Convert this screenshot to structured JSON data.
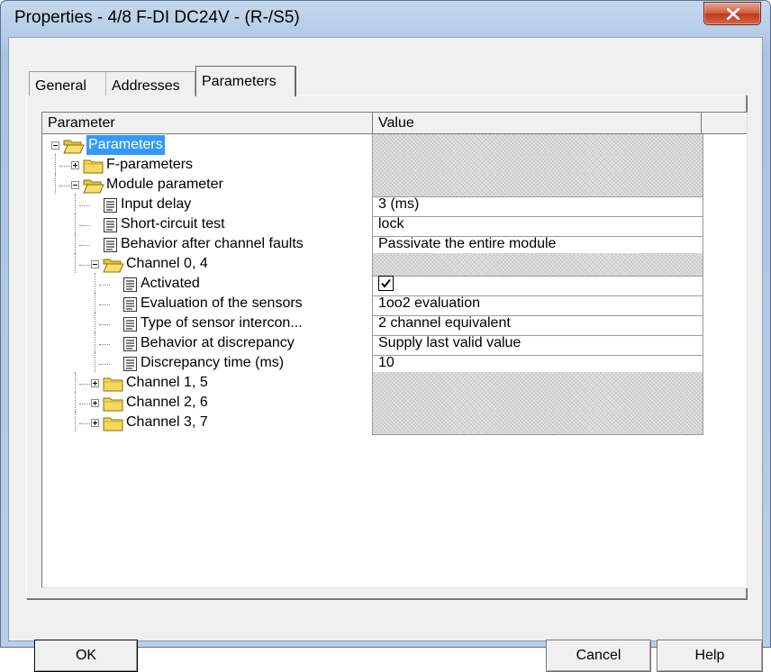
{
  "window": {
    "title": "Properties - 4/8 F-DI DC24V - (R-/S5)"
  },
  "tabs": [
    {
      "label": "General"
    },
    {
      "label": "Addresses"
    },
    {
      "label": "Parameters"
    }
  ],
  "table": {
    "col_parameter": "Parameter",
    "col_value": "Value",
    "rows": [
      {
        "label": "Parameters",
        "value": ""
      },
      {
        "label": "F-parameters",
        "value": ""
      },
      {
        "label": "Module parameter",
        "value": ""
      },
      {
        "label": "Input delay",
        "value": "3 (ms)"
      },
      {
        "label": "Short-circuit test",
        "value": "lock"
      },
      {
        "label": "Behavior after channel faults",
        "value": "Passivate the entire module"
      },
      {
        "label": "Channel 0, 4",
        "value": ""
      },
      {
        "label": "Activated",
        "value": "checked"
      },
      {
        "label": "Evaluation of the sensors",
        "value": "1oo2 evaluation"
      },
      {
        "label": "Type of sensor intercon...",
        "value": "2 channel equivalent"
      },
      {
        "label": "Behavior at discrepancy",
        "value": "Supply last valid value"
      },
      {
        "label": "Discrepancy time (ms)",
        "value": "10"
      },
      {
        "label": "Channel 1, 5",
        "value": ""
      },
      {
        "label": "Channel 2, 6",
        "value": ""
      },
      {
        "label": "Channel 3, 7",
        "value": ""
      }
    ]
  },
  "buttons": {
    "ok": "OK",
    "cancel": "Cancel",
    "help": "Help"
  },
  "icons": {
    "folder": "folder-icon",
    "parameter": "parameter-doc-icon",
    "close": "close-icon"
  },
  "colors": {
    "selection": "#3399ff",
    "folder": "#f5d95a",
    "close_button": "#c84a2e"
  }
}
